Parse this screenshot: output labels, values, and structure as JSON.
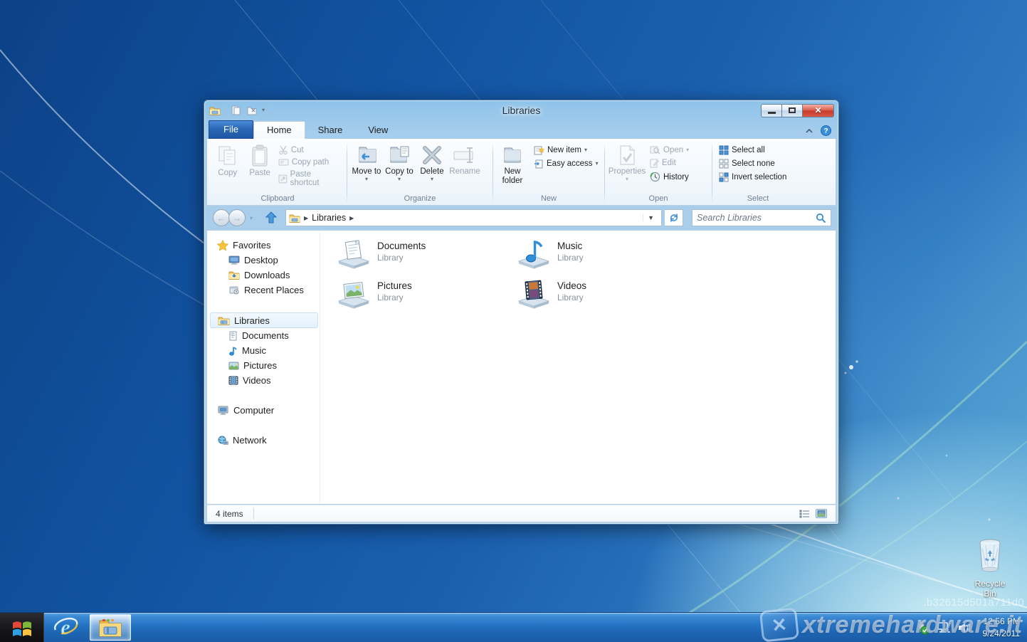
{
  "window": {
    "title": "Libraries"
  },
  "tabs": {
    "file": "File",
    "home": "Home",
    "share": "Share",
    "view": "View"
  },
  "ribbon": {
    "clipboard": {
      "group": "Clipboard",
      "copy": "Copy",
      "paste": "Paste",
      "cut": "Cut",
      "copy_path": "Copy path",
      "paste_shortcut": "Paste shortcut"
    },
    "organize": {
      "group": "Organize",
      "move_to": "Move to",
      "copy_to": "Copy to",
      "delete": "Delete",
      "rename": "Rename"
    },
    "new_group": {
      "group": "New",
      "new_folder": "New folder",
      "new_item": "New item",
      "easy_access": "Easy access"
    },
    "open_group": {
      "group": "Open",
      "properties": "Properties",
      "open": "Open",
      "edit": "Edit",
      "history": "History"
    },
    "select_group": {
      "group": "Select",
      "select_all": "Select all",
      "select_none": "Select none",
      "invert_selection": "Invert selection"
    }
  },
  "address": {
    "location": "Libraries",
    "search_placeholder": "Search Libraries"
  },
  "sidebar": {
    "favorites": {
      "label": "Favorites",
      "items": [
        {
          "label": "Desktop"
        },
        {
          "label": "Downloads"
        },
        {
          "label": "Recent Places"
        }
      ]
    },
    "libraries": {
      "label": "Libraries",
      "items": [
        {
          "label": "Documents"
        },
        {
          "label": "Music"
        },
        {
          "label": "Pictures"
        },
        {
          "label": "Videos"
        }
      ]
    },
    "computer": {
      "label": "Computer"
    },
    "network": {
      "label": "Network"
    }
  },
  "content": {
    "tiles": [
      {
        "name": "Documents",
        "sub": "Library"
      },
      {
        "name": "Music",
        "sub": "Library"
      },
      {
        "name": "Pictures",
        "sub": "Library"
      },
      {
        "name": "Videos",
        "sub": "Library"
      }
    ]
  },
  "status": {
    "item_count": "4 items"
  },
  "taskbar": {
    "time": "12:56 PM",
    "date": "9/24/2011"
  },
  "desktop": {
    "recycle_bin": "Recycle Bin",
    "watermark": "xtremehardware.it",
    "build_text": ".b32615d501a711d0"
  },
  "colors": {
    "desktop_blue": "#1253a4",
    "taskbar_blue": "#2371c2",
    "file_tab_blue": "#2c67b4",
    "close_red": "#c93b2d",
    "accent_blue": "#3f8fd6"
  }
}
